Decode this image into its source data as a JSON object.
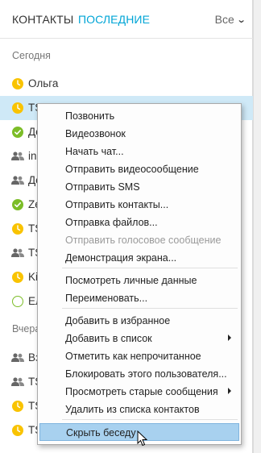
{
  "tabs": {
    "contacts": "КОНТАКТЫ",
    "recent": "ПОСЛЕДНИЕ",
    "filter": "Все"
  },
  "sections": {
    "today": "Сегодня",
    "yesterday": "Вчера"
  },
  "conversations": [
    {
      "name": "Ольга",
      "status": "away"
    },
    {
      "name": "TS",
      "status": "away",
      "selected": true
    },
    {
      "name": "Де",
      "status": "online"
    },
    {
      "name": "in",
      "status": "group"
    },
    {
      "name": "Де",
      "status": "group"
    },
    {
      "name": "Ze",
      "status": "online"
    },
    {
      "name": "TS",
      "status": "away"
    },
    {
      "name": "TS",
      "status": "group"
    },
    {
      "name": "Ki",
      "status": "away"
    },
    {
      "name": "Ел",
      "status": "offline"
    },
    {
      "name": "Вз",
      "status": "group"
    },
    {
      "name": "TS",
      "status": "group"
    },
    {
      "name": "TS",
      "status": "away"
    },
    {
      "name": "TS",
      "status": "away"
    }
  ],
  "context_menu": {
    "items": [
      {
        "label": "Позвонить"
      },
      {
        "label": "Видеозвонок"
      },
      {
        "label": "Начать чат..."
      },
      {
        "label": "Отправить видеосообщение"
      },
      {
        "label": "Отправить SMS"
      },
      {
        "label": "Отправить контакты..."
      },
      {
        "label": "Отправка файлов..."
      },
      {
        "label": "Отправить голосовое сообщение",
        "disabled": true
      },
      {
        "label": "Демонстрация экрана..."
      },
      {
        "label": "Посмотреть личные данные"
      },
      {
        "label": "Переименовать..."
      },
      {
        "label": "Добавить в избранное"
      },
      {
        "label": "Добавить в список",
        "submenu": true
      },
      {
        "label": "Отметить как непрочитанное"
      },
      {
        "label": "Блокировать этого пользователя..."
      },
      {
        "label": "Просмотреть старые сообщения",
        "submenu": true
      },
      {
        "label": "Удалить из списка контактов"
      },
      {
        "label": "Скрыть беседу",
        "hovered": true
      }
    ]
  },
  "colors": {
    "accent": "#00a5d6",
    "away": "#f9c300",
    "online": "#7cbd28",
    "selected_row": "#cfe9f7",
    "menu_hover": "#a8d1ef"
  }
}
